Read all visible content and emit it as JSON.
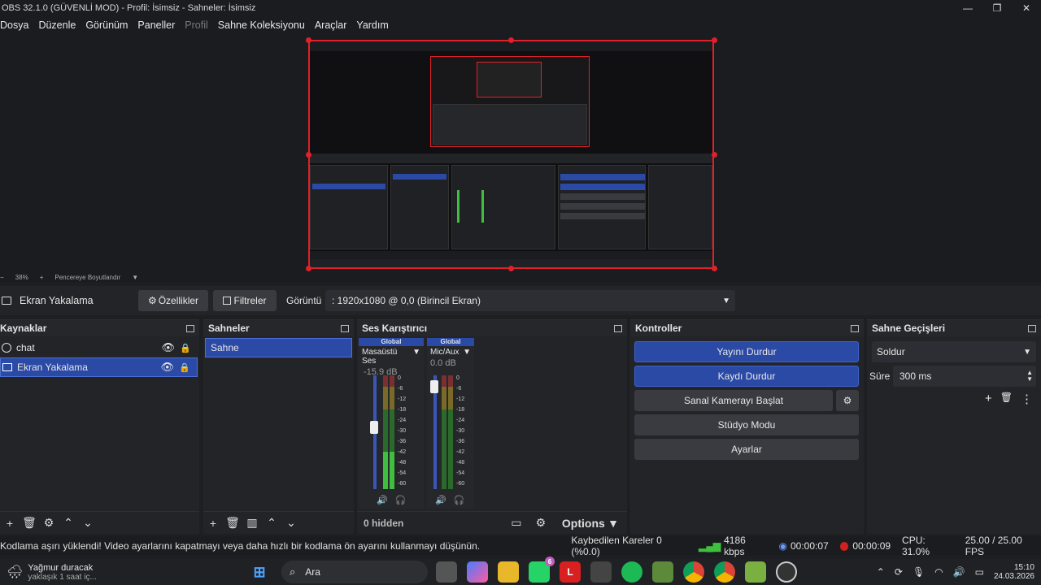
{
  "window": {
    "title": "OBS 32.1.0 (GÜVENLİ MOD) - Profil: İsimsiz - Sahneler: İsimsiz",
    "minimize": "—",
    "maximize": "❐",
    "close": "✕"
  },
  "menu": [
    {
      "label": "Dosya"
    },
    {
      "label": "Düzenle"
    },
    {
      "label": "Görünüm"
    },
    {
      "label": "Paneller"
    },
    {
      "label": "Profil"
    },
    {
      "label": "Sahne Koleksiyonu"
    },
    {
      "label": "Araçlar"
    },
    {
      "label": "Yardım"
    }
  ],
  "zoom": {
    "minus": "−",
    "value": "38%",
    "plus": "+",
    "fit_label": "Pencereye Boyutlandır",
    "dropdown": "▼"
  },
  "source_toolbar": {
    "source_name": "Ekran Yakalama",
    "properties_label": "Özellikler",
    "filters_label": "Filtreler",
    "display_label": "Görüntü",
    "display_value": ": 1920x1080 @ 0,0 (Birincil Ekran)"
  },
  "docks": {
    "sources": {
      "title": "Kaynaklar",
      "items": [
        {
          "label": "chat"
        },
        {
          "label": "Ekran Yakalama"
        }
      ]
    },
    "scenes": {
      "title": "Sahneler",
      "items": [
        {
          "label": "Sahne"
        }
      ]
    },
    "mixer": {
      "title": "Ses Karıştırıcı",
      "channels": [
        {
          "badge": "Global",
          "name": "Masaüstü Ses",
          "db": "-15.9 dB",
          "level": 0.55
        },
        {
          "badge": "Global",
          "name": "Mic/Aux",
          "db": "0.0 dB",
          "level": 0.95
        }
      ],
      "scale": [
        "0",
        "-6",
        "-12",
        "-18",
        "-24",
        "-30",
        "-36",
        "-42",
        "-48",
        "-54",
        "-60"
      ],
      "hidden_label": "0 hidden",
      "options_label": "Options"
    },
    "controls": {
      "title": "Kontroller",
      "stop_stream": "Yayını Durdur",
      "stop_record": "Kaydı Durdur",
      "virtual_cam": "Sanal Kamerayı Başlat",
      "studio_mode": "Stüdyo Modu",
      "settings": "Ayarlar"
    },
    "transitions": {
      "title": "Sahne Geçişleri",
      "transition": "Soldur",
      "duration_label": "Süre",
      "duration_value": "300 ms"
    }
  },
  "status": {
    "message": "Kodlama aşırı yüklendi! Video ayarlarını kapatmayı veya daha hızlı bir kodlama ön ayarını kullanmayı düşünün.",
    "dropped": "Kaybedilen Kareler 0 (%0.0)",
    "bitrate": "4186 kbps",
    "stream_time": "00:00:07",
    "rec_time": "00:00:09",
    "cpu": "CPU: 31.0%",
    "fps": "25.00 / 25.00 FPS"
  },
  "taskbar": {
    "weather_title": "Yağmur duracak",
    "weather_sub": "yaklaşık 1 saat iç...",
    "search": "Ara",
    "whatsapp_badge": "6",
    "time": "15:10",
    "date": "24.03.2026"
  },
  "colors": {
    "accent": "#2b4aa6",
    "preview_border": "#e0202a",
    "meter_green": "#3fbf3f",
    "meter_yellow": "#c8b030",
    "meter_red": "#c03030"
  }
}
